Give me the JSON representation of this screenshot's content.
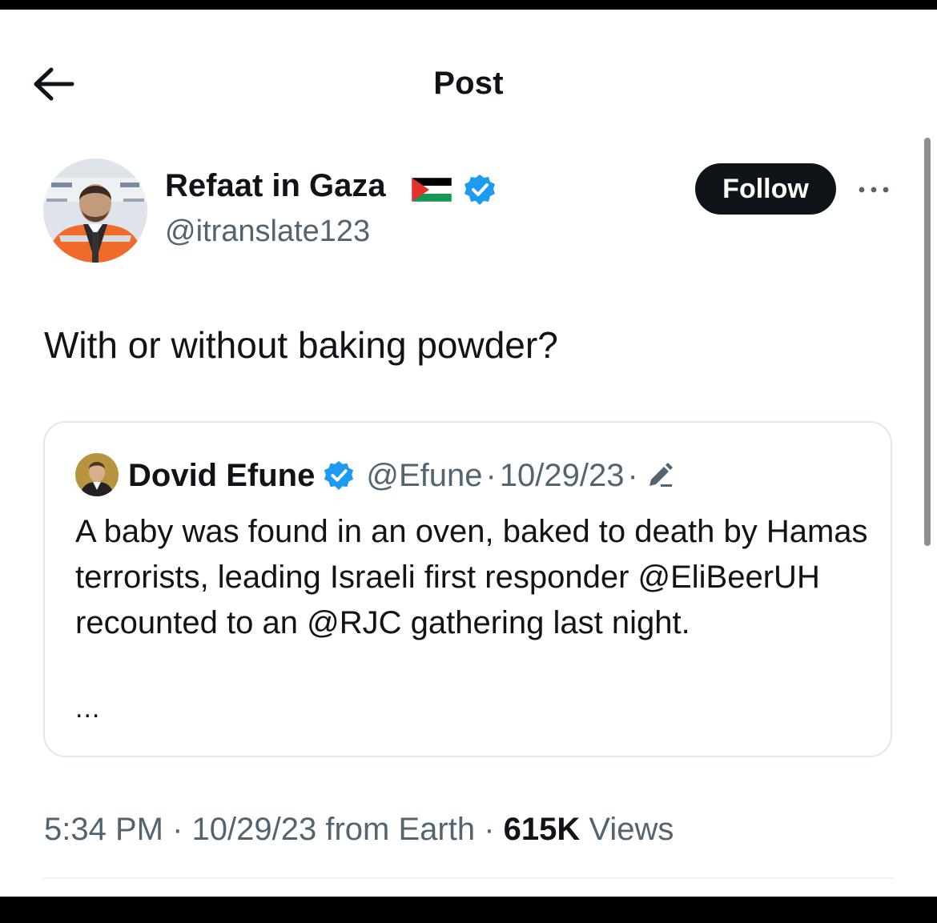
{
  "header": {
    "title": "Post",
    "back_icon": "arrow-left-icon"
  },
  "post": {
    "author": {
      "name": "Refaat in Gaza",
      "flag_icon": "palestine-flag-icon",
      "verified_icon": "verified-badge-icon",
      "handle": "@itranslate123"
    },
    "follow_label": "Follow",
    "more_icon": "more-options-icon",
    "text": "With or without baking powder?",
    "quoted": {
      "name": "Dovid Efune",
      "verified_icon": "verified-badge-icon",
      "handle": "@Efune",
      "separator": "·",
      "date": "10/29/23",
      "edit_icon": "edited-pencil-icon",
      "text": "A baby was found in an oven, baked to death by Hamas terrorists, leading Israeli first responder @EliBeerUH recounted to an @RJC gathering last night.",
      "truncation": "..."
    },
    "meta": {
      "time": "5:34 PM",
      "separator": "·",
      "date": "10/29/23",
      "source": "from Earth",
      "views_count": "615K",
      "views_label": "Views"
    }
  },
  "colors": {
    "text_primary": "#0f1419",
    "text_secondary": "#536471",
    "verified_blue": "#1d9bf0",
    "border": "#e1e8ed",
    "follow_bg": "#0f1419"
  }
}
